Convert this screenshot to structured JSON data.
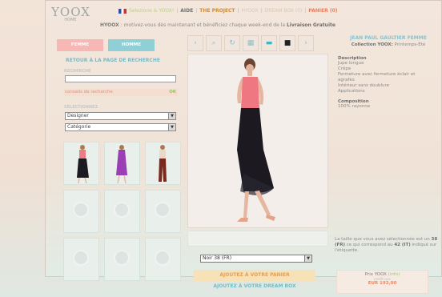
{
  "brand": {
    "logo": "YOOX",
    "home": "HOME"
  },
  "topnav": {
    "change_country": "Selezione & YOOX!",
    "help": "AIDE",
    "project": "THE PROJECT",
    "hyoox": "HYOOX",
    "dream_box": "DREAM BOX (0)",
    "basket": "PANIER (0)"
  },
  "promo": {
    "brand": "HYOOX",
    "text": ": motivez-vous dès maintenant et bénéficiez chaque week-end de la",
    "highlight": "Livraison Gratuite"
  },
  "gender": {
    "femme": "FEMME",
    "homme": "HOMME"
  },
  "search": {
    "back_label": "RETOUR À LA PAGE DE RECHERCHE",
    "label": "RECHERCHE",
    "value": "",
    "tips": "conseils de recherche",
    "ok": "OK"
  },
  "filters": {
    "label": "SÉLECTIONNEZ",
    "designer": "Designer",
    "category": "Catégorie"
  },
  "toolbar": [
    "zoom-out",
    "zoom-in",
    "rotate",
    "grid",
    "color",
    "black",
    "next"
  ],
  "product": {
    "designer": "JEAN PAUL GAULTIER FEMME",
    "collection_label": "Collection YOOX:",
    "collection": "Printemps-Été",
    "description_title": "Description",
    "description": [
      "Jupe longue",
      "Crêpe",
      "Fermeture avec fermeture éclair et",
      "agrafes",
      "Intérieur sans doublure",
      "Applications"
    ],
    "composition_title": "Composition",
    "composition": "100% rayonne",
    "size_note_pre": "La taille que vous avez sélectionnée",
    "size_note_mid1": "est un",
    "size_selected": "38 (FR)",
    "size_note_mid2": "ce qui correspond au",
    "size_equiv": "42 (IT)",
    "size_note_post": "indiqué sur l'étiquette.",
    "size_option": "Noir 38 (FR)",
    "price_label": "Prix YOOX",
    "price_info": "(info)",
    "price_sub": "plutôt que",
    "price": "EUR 192,00"
  },
  "actions": {
    "add_to_basket": "AJOUTEZ À VOTRE PANIER",
    "add_to_dream": "AJOUTEZ À VOTRE DREAM BOX"
  },
  "colors": {
    "accent_teal": "#88c3cf",
    "accent_pink": "#f7b7b4",
    "accent_orange": "#e39f5a",
    "price": "#e98a6a"
  }
}
